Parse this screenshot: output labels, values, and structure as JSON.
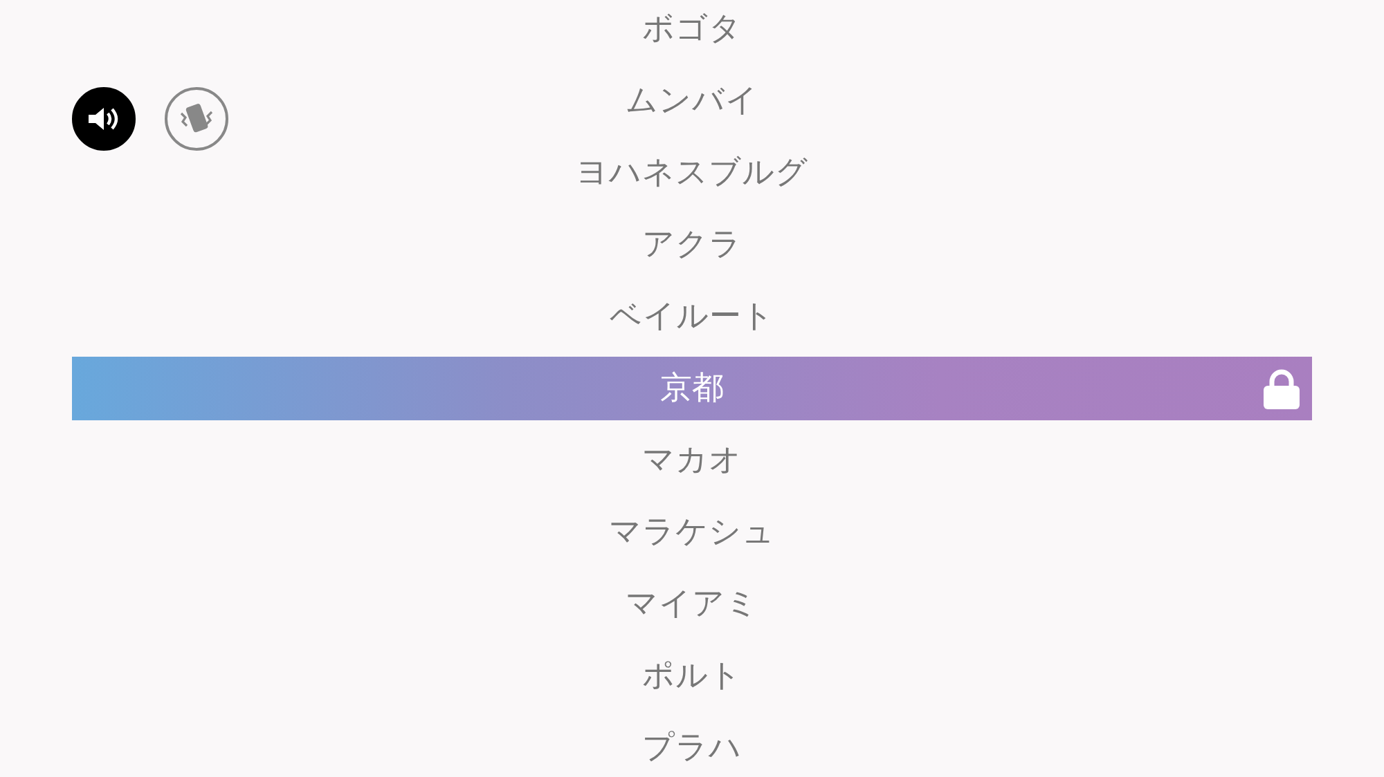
{
  "toggles": [
    {
      "kind": "sound",
      "selected": true
    },
    {
      "kind": "vibrate",
      "selected": false
    }
  ],
  "cities": [
    {
      "label": "ボゴタ",
      "selected": false,
      "locked": false
    },
    {
      "label": "ムンバイ",
      "selected": false,
      "locked": false
    },
    {
      "label": "ヨハネスブルグ",
      "selected": false,
      "locked": false
    },
    {
      "label": "アクラ",
      "selected": false,
      "locked": false
    },
    {
      "label": "ベイルート",
      "selected": false,
      "locked": false
    },
    {
      "label": "京都",
      "selected": true,
      "locked": true
    },
    {
      "label": "マカオ",
      "selected": false,
      "locked": false
    },
    {
      "label": "マラケシュ",
      "selected": false,
      "locked": false
    },
    {
      "label": "マイアミ",
      "selected": false,
      "locked": false
    },
    {
      "label": "ポルト",
      "selected": false,
      "locked": false
    },
    {
      "label": "プラハ",
      "selected": false,
      "locked": false
    }
  ]
}
